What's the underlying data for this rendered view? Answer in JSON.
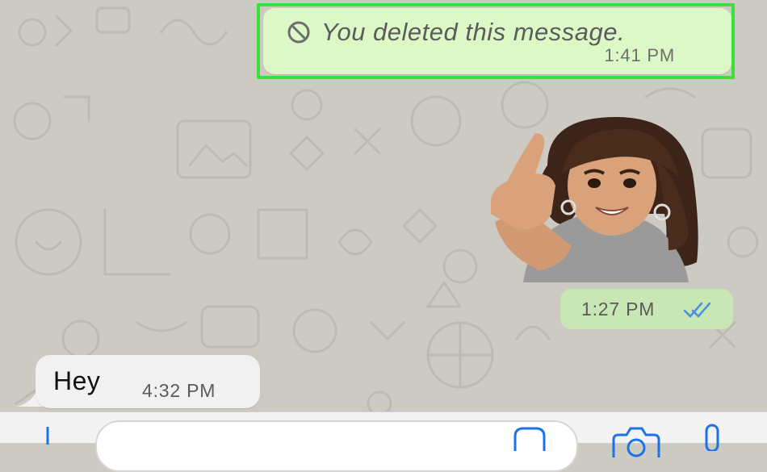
{
  "messages": {
    "deleted": {
      "text": "You deleted this message.",
      "time": "1:41 PM"
    },
    "sticker": {
      "time": "1:27 PM",
      "status": "read"
    },
    "incoming": {
      "text": "Hey",
      "time": "4:32 PM"
    }
  },
  "composer": {
    "icons": [
      "plus-icon",
      "sticker-icon",
      "camera-icon",
      "microphone-icon"
    ]
  },
  "colors": {
    "outgoing_bubble": "#dcf8c6",
    "incoming_bubble": "#f1f1f1",
    "highlight": "#3be13b",
    "read_ticks": "#4a90e2",
    "wallpaper": "#cdcac4"
  }
}
